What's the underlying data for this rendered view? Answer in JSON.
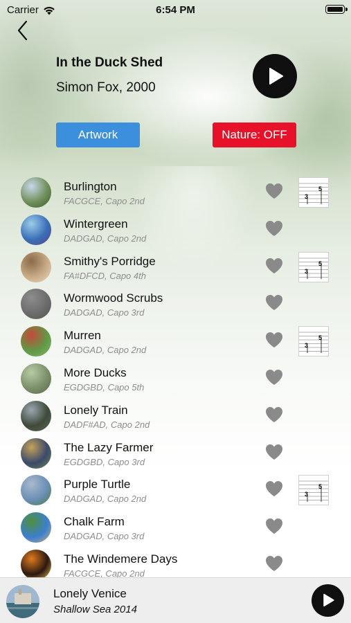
{
  "status_bar": {
    "carrier": "Carrier",
    "time": "6:54 PM"
  },
  "album": {
    "title": "In the Duck Shed",
    "subtitle": "Simon Fox, 2000"
  },
  "buttons": {
    "artwork": "Artwork",
    "nature": "Nature: OFF"
  },
  "colors": {
    "artwork_button": "#3b8fdc",
    "nature_button": "#e8112a",
    "play_button": "#0f0f0f",
    "heart": "#8a8a8a",
    "tuning_text": "#8e8e8e"
  },
  "tracks": [
    {
      "title": "Burlington",
      "tuning": "FACGCE, Capo 2nd",
      "has_tab": true
    },
    {
      "title": "Wintergreen",
      "tuning": "DADGAD, Capo 2nd",
      "has_tab": false
    },
    {
      "title": "Smithy's Porridge",
      "tuning": "FA#DFCD, Capo 4th",
      "has_tab": true
    },
    {
      "title": "Wormwood Scrubs",
      "tuning": "DADGAD, Capo 3rd",
      "has_tab": false
    },
    {
      "title": "Murren",
      "tuning": "DADGAD, Capo 2nd",
      "has_tab": true
    },
    {
      "title": "More Ducks",
      "tuning": "EGDGBD, Capo 5th",
      "has_tab": false
    },
    {
      "title": "Lonely Train",
      "tuning": "DADF#AD, Capo 2nd",
      "has_tab": false
    },
    {
      "title": "The Lazy Farmer",
      "tuning": "EGDGBD, Capo 3rd",
      "has_tab": false
    },
    {
      "title": "Purple Turtle",
      "tuning": "DADGAD, Capo 2nd",
      "has_tab": true
    },
    {
      "title": "Chalk Farm",
      "tuning": "DADGAD, Capo 3rd",
      "has_tab": false
    },
    {
      "title": "The Windemere Days",
      "tuning": "FACGCE, Capo 2nd",
      "has_tab": false
    }
  ],
  "tab_icon": {
    "fret_top": "5",
    "fret_bottom": "3"
  },
  "now_playing": {
    "title": "Lonely Venice",
    "subtitle": "Shallow Sea 2014"
  }
}
